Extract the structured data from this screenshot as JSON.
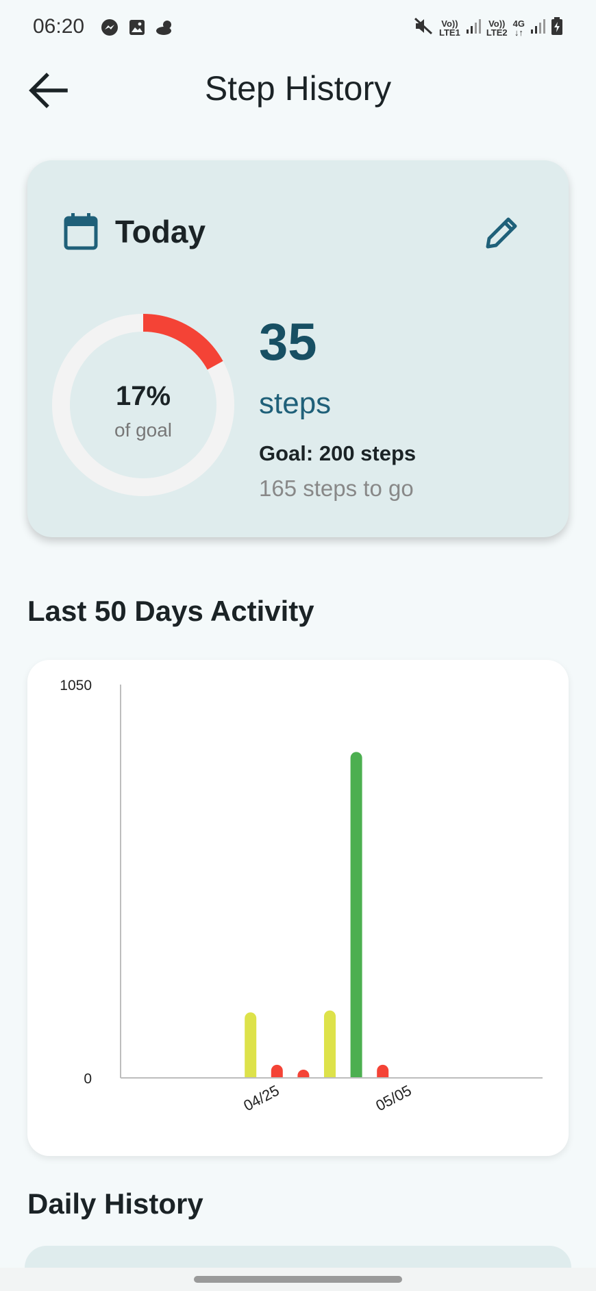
{
  "status_bar": {
    "time": "06:20",
    "left_icons": [
      "messenger-icon",
      "gallery-icon",
      "weather-icon"
    ],
    "network": [
      {
        "top": "Vo))",
        "bottom": "LTE1"
      },
      {
        "top": "Vo))",
        "bottom": "LTE2"
      },
      {
        "top": "4G",
        "bottom": "↓↑"
      }
    ],
    "right_icons": [
      "mute-icon",
      "signal-icon",
      "signal-icon",
      "battery-charging-icon"
    ]
  },
  "app_bar": {
    "back_icon": "arrow-left-icon",
    "title": "Step History"
  },
  "today_card": {
    "label": "Today",
    "calendar_icon": "calendar-icon",
    "edit_icon": "pencil-icon",
    "progress_fraction": 0.17,
    "progress_percent": "17%",
    "progress_sub": "of goal",
    "steps": "35",
    "steps_unit": "steps",
    "goal": "Goal: 200 steps",
    "remaining": "165 steps to go",
    "colors": {
      "progress": "#f44336",
      "track": "#f3f3f3",
      "accent": "#174f63"
    }
  },
  "activity_section": {
    "title": "Last 50 Days Activity"
  },
  "chart_data": {
    "type": "bar",
    "ylim": [
      0,
      1050
    ],
    "y_ticks": [
      "1050",
      "0"
    ],
    "x_ticks": [
      "04/25",
      "05/05"
    ],
    "bars": [
      {
        "day_offset": -1,
        "value": 175,
        "color": "#dde24a"
      },
      {
        "day_offset": 1,
        "value": 35,
        "color": "#f44336"
      },
      {
        "day_offset": 3,
        "value": 22,
        "color": "#f44336"
      },
      {
        "day_offset": 5,
        "value": 180,
        "color": "#dde24a"
      },
      {
        "day_offset": 7,
        "value": 870,
        "color": "#4caf50"
      },
      {
        "day_offset": 9,
        "value": 35,
        "color": "#f44336"
      }
    ],
    "x_tick_offsets": [
      0,
      10
    ],
    "grid": false
  },
  "history_section": {
    "title": "Daily History"
  }
}
